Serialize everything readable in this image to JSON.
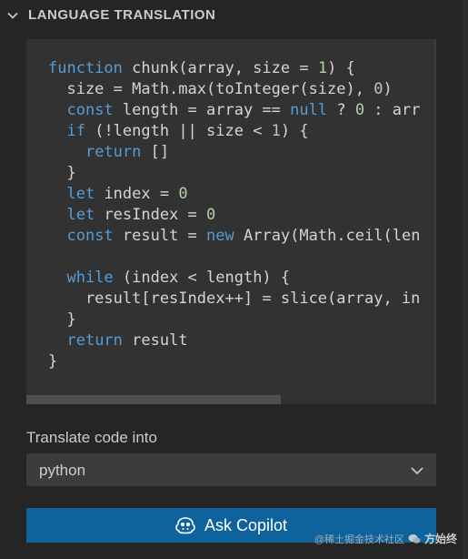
{
  "panel": {
    "title": "LANGUAGE TRANSLATION",
    "collapse_icon": "chevron-down-icon"
  },
  "code": {
    "lines": [
      [
        {
          "t": "kw",
          "v": "function"
        },
        {
          "t": "txt",
          "v": " chunk(array, size = "
        },
        {
          "t": "num",
          "v": "1"
        },
        {
          "t": "txt",
          "v": ") {"
        }
      ],
      [
        {
          "t": "txt",
          "v": "  size = Math.max(toInteger(size), "
        },
        {
          "t": "num",
          "v": "0"
        },
        {
          "t": "txt",
          "v": ")"
        }
      ],
      [
        {
          "t": "txt",
          "v": "  "
        },
        {
          "t": "kw",
          "v": "const"
        },
        {
          "t": "txt",
          "v": " length = array == "
        },
        {
          "t": "kw",
          "v": "null"
        },
        {
          "t": "txt",
          "v": " ? "
        },
        {
          "t": "num",
          "v": "0"
        },
        {
          "t": "txt",
          "v": " : arr"
        }
      ],
      [
        {
          "t": "txt",
          "v": "  "
        },
        {
          "t": "kw",
          "v": "if"
        },
        {
          "t": "txt",
          "v": " (!length || size < "
        },
        {
          "t": "num",
          "v": "1"
        },
        {
          "t": "txt",
          "v": ") {"
        }
      ],
      [
        {
          "t": "txt",
          "v": "    "
        },
        {
          "t": "kw",
          "v": "return"
        },
        {
          "t": "txt",
          "v": " []"
        }
      ],
      [
        {
          "t": "txt",
          "v": "  }"
        }
      ],
      [
        {
          "t": "txt",
          "v": "  "
        },
        {
          "t": "kw",
          "v": "let"
        },
        {
          "t": "txt",
          "v": " index = "
        },
        {
          "t": "num",
          "v": "0"
        }
      ],
      [
        {
          "t": "txt",
          "v": "  "
        },
        {
          "t": "kw",
          "v": "let"
        },
        {
          "t": "txt",
          "v": " resIndex = "
        },
        {
          "t": "num",
          "v": "0"
        }
      ],
      [
        {
          "t": "txt",
          "v": "  "
        },
        {
          "t": "kw",
          "v": "const"
        },
        {
          "t": "txt",
          "v": " result = "
        },
        {
          "t": "kw",
          "v": "new"
        },
        {
          "t": "txt",
          "v": " Array(Math.ceil(len"
        }
      ],
      [
        {
          "t": "txt",
          "v": ""
        }
      ],
      [
        {
          "t": "txt",
          "v": "  "
        },
        {
          "t": "kw",
          "v": "while"
        },
        {
          "t": "txt",
          "v": " (index < length) {"
        }
      ],
      [
        {
          "t": "txt",
          "v": "    result[resIndex++] = slice(array, in"
        }
      ],
      [
        {
          "t": "txt",
          "v": "  }"
        }
      ],
      [
        {
          "t": "txt",
          "v": "  "
        },
        {
          "t": "kw",
          "v": "return"
        },
        {
          "t": "txt",
          "v": " result"
        }
      ],
      [
        {
          "t": "txt",
          "v": "}"
        }
      ]
    ],
    "horizontal_scroll_fraction": 0.62
  },
  "translate": {
    "label": "Translate code into",
    "selected": "python",
    "dropdown_icon": "chevron-down-icon"
  },
  "ask_button": {
    "label": "Ask Copilot",
    "icon": "copilot-icon"
  },
  "watermark": {
    "text": "@稀土掘金技术社区",
    "author": "方始终",
    "icon": "wechat-icon"
  },
  "colors": {
    "background": "#252526",
    "code_background": "#323233",
    "keyword": "#569cd6",
    "number": "#b5cea8",
    "text": "#d4d4d4",
    "button": "#0e639c",
    "select_background": "#3c3c3c"
  }
}
